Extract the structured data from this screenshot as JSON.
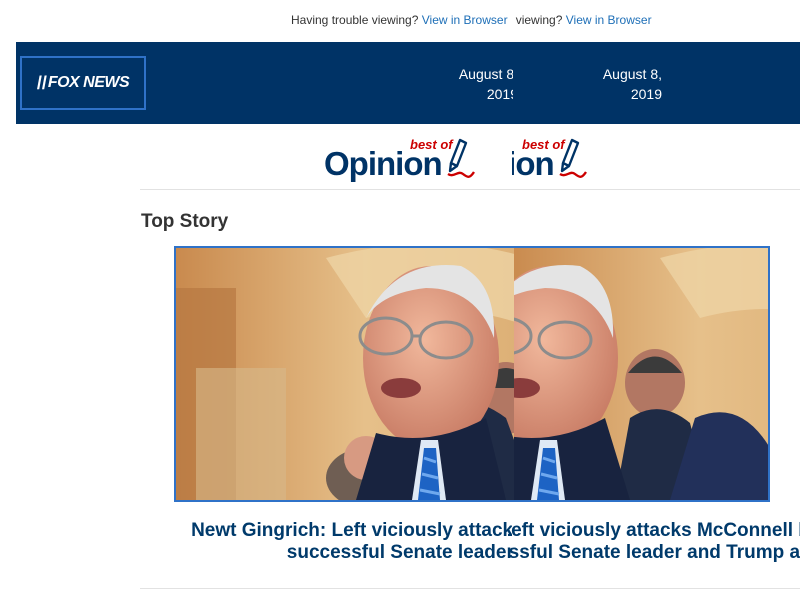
{
  "notice": {
    "text": "Having trouble viewing?",
    "link": "View in Browser"
  },
  "header": {
    "logo": "FOX NEWS",
    "date_line1": "August 8,",
    "date_line2": "2019"
  },
  "banner": {
    "best_of": "best of",
    "opinion": "Opinion"
  },
  "section": {
    "title": "Top Story"
  },
  "story": {
    "headline": "Newt Gingrich: Left viciously attacks McConnell because he’s successful Senate leader and Trump ally"
  },
  "colors": {
    "header_bg": "#003366",
    "link": "#1e6fb7",
    "best_of_red": "#cc0000",
    "headline": "#003a6b"
  }
}
